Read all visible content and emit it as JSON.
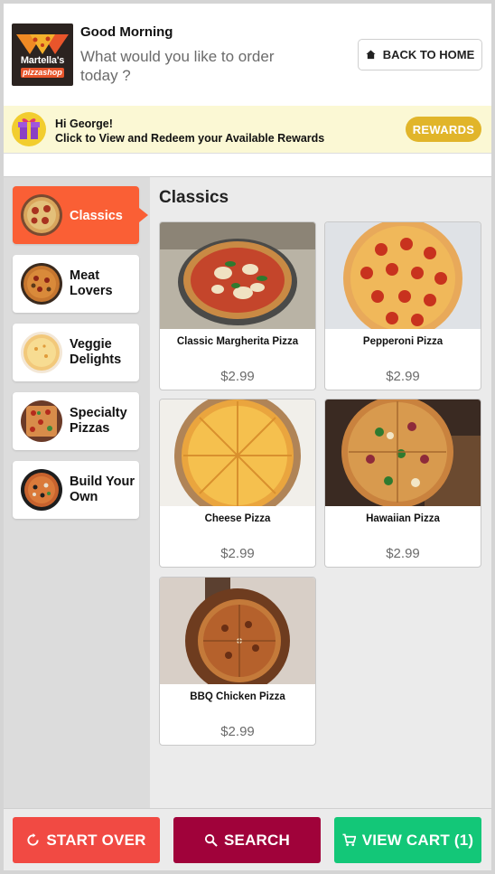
{
  "header": {
    "logo": {
      "line1": "Martella's",
      "line2": "pizzashop"
    },
    "greeting": "Good Morning",
    "subtitle": "What would you like to order today ?",
    "back_button": {
      "label": "BACK TO HOME",
      "icon": "home-icon"
    }
  },
  "rewards": {
    "line1": "Hi George!",
    "line2": "Click to View and Redeem your Available Rewards",
    "button_label": "REWARDS",
    "icon": "gift-icon"
  },
  "sidebar": {
    "items": [
      {
        "label": "Classics",
        "active": true
      },
      {
        "label": "Meat Lovers",
        "active": false
      },
      {
        "label": "Veggie Delights",
        "active": false
      },
      {
        "label": "Specialty Pizzas",
        "active": false
      },
      {
        "label": "Build Your Own",
        "active": false
      }
    ]
  },
  "main": {
    "section_title": "Classics",
    "products": [
      {
        "name": "Classic Margherita Pizza",
        "price": "$2.99"
      },
      {
        "name": "Pepperoni Pizza",
        "price": "$2.99"
      },
      {
        "name": "Cheese Pizza",
        "price": "$2.99"
      },
      {
        "name": "Hawaiian Pizza",
        "price": "$2.99"
      },
      {
        "name": "BBQ Chicken Pizza",
        "price": "$2.99"
      }
    ]
  },
  "footer": {
    "start_over": {
      "label": "START OVER",
      "icon": "refresh-icon"
    },
    "search": {
      "label": "SEARCH",
      "icon": "search-icon"
    },
    "view_cart": {
      "label": "VIEW CART (1)",
      "icon": "cart-icon"
    }
  },
  "colors": {
    "accent_orange": "#fa5f35",
    "rewards_gold": "#e1b52a",
    "start_over_red": "#f14a43",
    "search_maroon": "#a0023a",
    "cart_green": "#13c778"
  }
}
